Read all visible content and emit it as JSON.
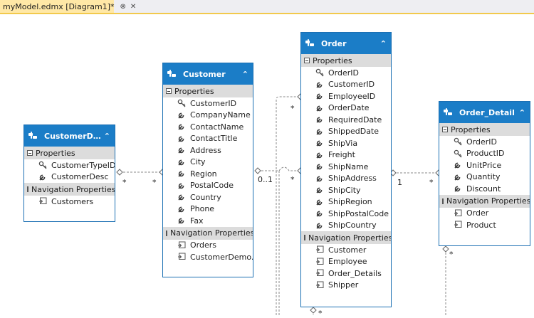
{
  "tab": {
    "title": "myModel.edmx [Diagram1]*",
    "pin_icon": "pin-icon",
    "close_icon": "close-icon"
  },
  "colors": {
    "header": "#1b7dc7",
    "section": "#dcdcdc",
    "tab": "#ffe8a6",
    "tab_border": "#f2c94c"
  },
  "entities": {
    "customer_demo": {
      "name": "CustomerDem...",
      "properties_label": "Properties",
      "properties": [
        "CustomerTypeID",
        "CustomerDesc"
      ],
      "nav_label": "Navigation Properties",
      "nav": [
        "Customers"
      ]
    },
    "customer": {
      "name": "Customer",
      "properties_label": "Properties",
      "properties": [
        "CustomerID",
        "CompanyName",
        "ContactName",
        "ContactTitle",
        "Address",
        "City",
        "Region",
        "PostalCode",
        "Country",
        "Phone",
        "Fax"
      ],
      "nav_label": "Navigation Properties",
      "nav": [
        "Orders",
        "CustomerDemo..."
      ]
    },
    "order": {
      "name": "Order",
      "properties_label": "Properties",
      "properties": [
        "OrderID",
        "CustomerID",
        "EmployeeID",
        "OrderDate",
        "RequiredDate",
        "ShippedDate",
        "ShipVia",
        "Freight",
        "ShipName",
        "ShipAddress",
        "ShipCity",
        "ShipRegion",
        "ShipPostalCode",
        "ShipCountry"
      ],
      "nav_label": "Navigation Properties",
      "nav": [
        "Customer",
        "Employee",
        "Order_Details",
        "Shipper"
      ]
    },
    "order_detail": {
      "name": "Order_Detail",
      "properties_label": "Properties",
      "properties": [
        "OrderID",
        "ProductID",
        "UnitPrice",
        "Quantity",
        "Discount"
      ],
      "nav_label": "Navigation Properties",
      "nav": [
        "Order",
        "Product"
      ]
    }
  },
  "multiplicities": {
    "cd_left": "*",
    "cd_right": "*",
    "co_left": "0..1",
    "co_right": "*",
    "co_top": "*",
    "od_left": "1",
    "od_right": "*",
    "order_bottom": "*",
    "detail_bottom": "*"
  }
}
